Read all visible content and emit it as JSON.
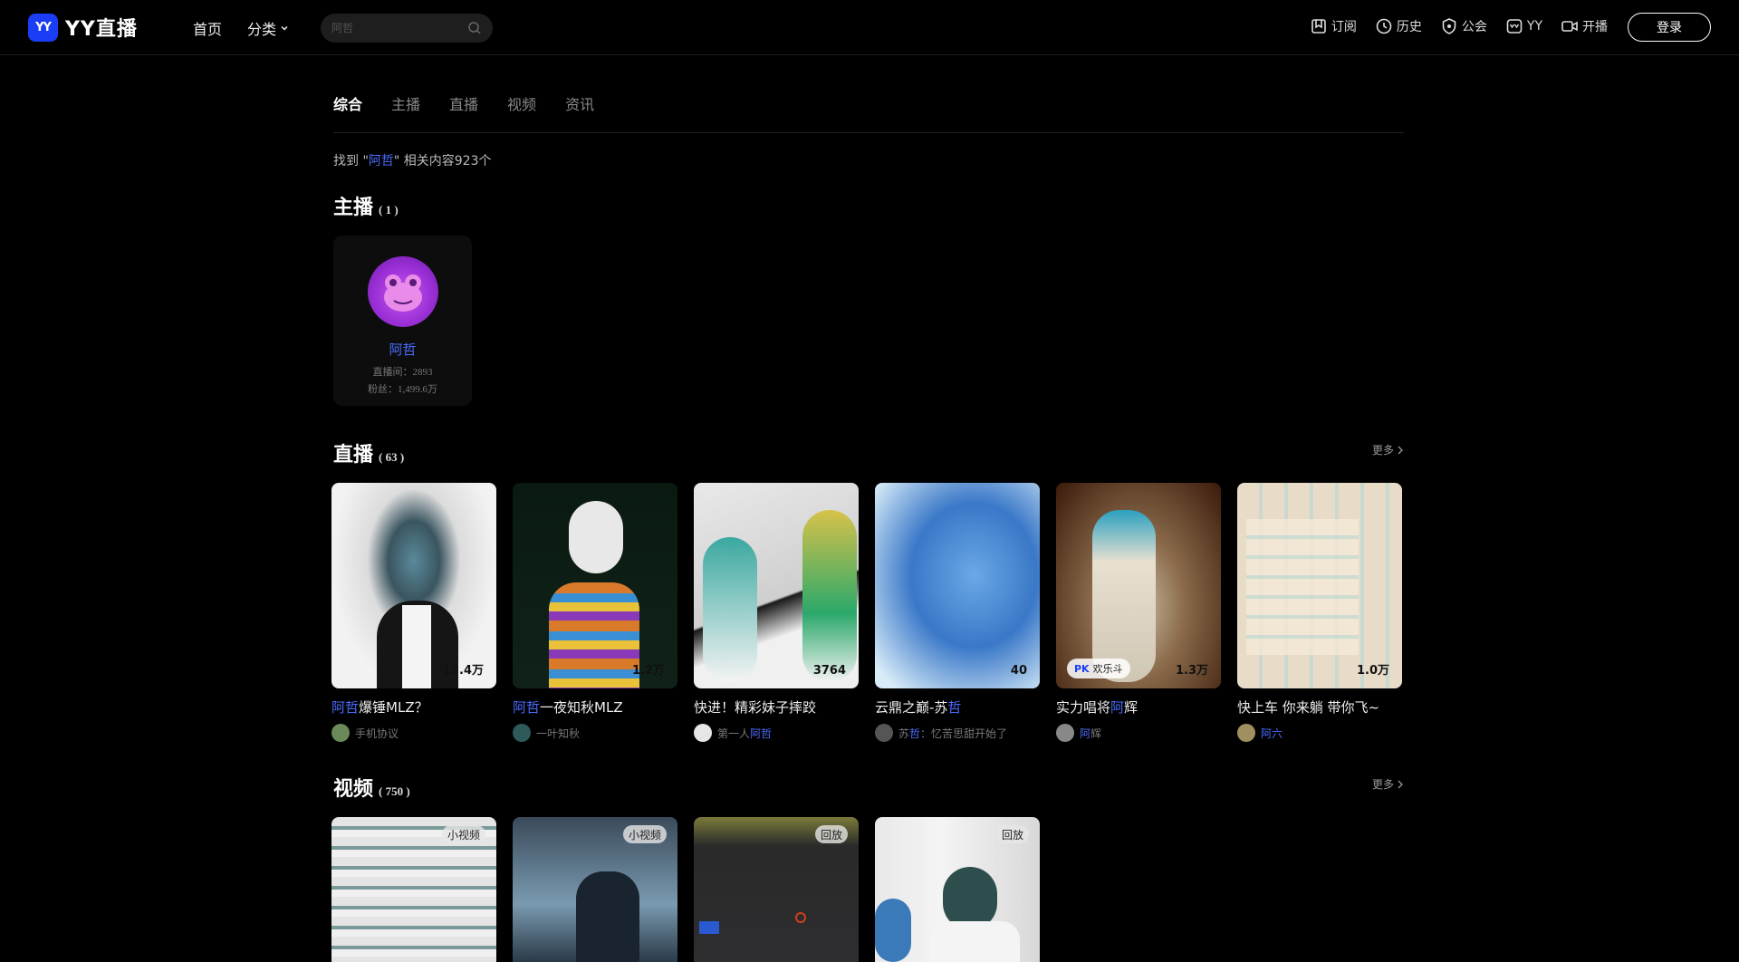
{
  "header": {
    "logo_badge": "YY",
    "logo_text": "YY直播",
    "nav": [
      "首页",
      "分类"
    ],
    "search_value": "阿哲",
    "right_nav": [
      {
        "label": "订阅",
        "icon": "bookmark-icon"
      },
      {
        "label": "历史",
        "icon": "clock-icon"
      },
      {
        "label": "公会",
        "icon": "shield-icon"
      },
      {
        "label": "YY",
        "icon": "yy-icon"
      },
      {
        "label": "开播",
        "icon": "video-camera-icon"
      }
    ],
    "login": "登录"
  },
  "tabs": [
    "综合",
    "主播",
    "直播",
    "视频",
    "资讯"
  ],
  "found": {
    "prefix": "找到 \"",
    "keyword": "阿哲",
    "suffix": "\" 相关内容923个"
  },
  "streamers": {
    "title": "主播",
    "count": "( 1 )",
    "items": [
      {
        "name": "阿哲",
        "room": "直播间：2893",
        "fans": "粉丝：1,499.6万"
      }
    ]
  },
  "live": {
    "title": "直播",
    "count": "( 63 )",
    "more": "更多",
    "items": [
      {
        "title_kw": "阿哲",
        "title_rest": "爆锤MLZ？",
        "count": "13.4万",
        "sub_kw": "",
        "sub": "手机协议"
      },
      {
        "title_kw": "阿哲",
        "title_rest": "一夜知秋MLZ",
        "count": "1.2万",
        "sub_kw": "",
        "sub": "一叶知秋"
      },
      {
        "title_pre": "快进！精彩妹子摔跤",
        "count": "3764",
        "sub_pre": "第一人",
        "sub_kw": "阿哲"
      },
      {
        "title_pre": "云鼎之巅-苏",
        "title_kw": "哲",
        "count": "40",
        "sub_pre": "苏",
        "sub_kw": "哲",
        "sub": "：忆苦思甜开始了"
      },
      {
        "title_pre": "实力唱将",
        "title_kw": "阿",
        "title_rest": "辉",
        "count": "1.3万",
        "badge": "欢乐斗",
        "sub_kw": "阿",
        "sub": "辉"
      },
      {
        "title_pre": "快上车 你来躺 带你飞~",
        "count": "1.0万",
        "sub_kw": "阿",
        "sub": "六"
      }
    ]
  },
  "videos": {
    "title": "视频",
    "count": "( 750 )",
    "more": "更多",
    "items": [
      {
        "tag": "小视频"
      },
      {
        "tag": "小视频"
      },
      {
        "tag": "回放"
      },
      {
        "tag": "回放"
      }
    ]
  },
  "colors": {
    "accent": "#4a6cff",
    "brand": "#1a3df5",
    "background": "#000000"
  }
}
